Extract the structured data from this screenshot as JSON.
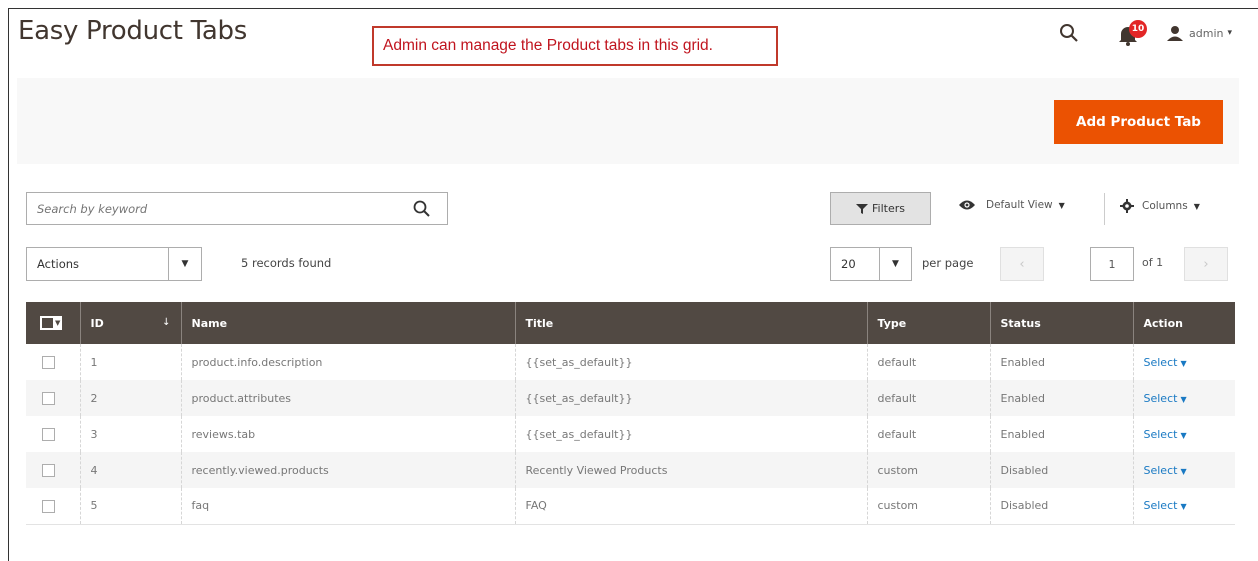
{
  "header": {
    "title": "Easy Product Tabs",
    "annotation": "Admin can manage the Product tabs in this grid.",
    "notification_count": "10",
    "user_name": "admin"
  },
  "actions_bar": {
    "add_button_label": "Add Product Tab"
  },
  "toolbar": {
    "search_placeholder": "Search by keyword",
    "filters_label": "Filters",
    "default_view_label": "Default View",
    "columns_label": "Columns",
    "actions_label": "Actions",
    "records_found": "5 records found",
    "per_page_value": "20",
    "per_page_label": "per page",
    "current_page": "1",
    "total_pages_label": "of 1"
  },
  "table": {
    "columns": [
      "ID",
      "Name",
      "Title",
      "Type",
      "Status",
      "Action"
    ],
    "rows": [
      {
        "id": "1",
        "name": "product.info.description",
        "title": "{{set_as_default}}",
        "type": "default",
        "status": "Enabled",
        "action": "Select"
      },
      {
        "id": "2",
        "name": "product.attributes",
        "title": "{{set_as_default}}",
        "type": "default",
        "status": "Enabled",
        "action": "Select"
      },
      {
        "id": "3",
        "name": "reviews.tab",
        "title": "{{set_as_default}}",
        "type": "default",
        "status": "Enabled",
        "action": "Select"
      },
      {
        "id": "4",
        "name": "recently.viewed.products",
        "title": "Recently Viewed Products",
        "type": "custom",
        "status": "Disabled",
        "action": "Select"
      },
      {
        "id": "5",
        "name": "faq",
        "title": "FAQ",
        "type": "custom",
        "status": "Disabled",
        "action": "Select"
      }
    ]
  },
  "colors": {
    "accent": "#eb5202",
    "header_bg": "#514943",
    "link": "#1979c3",
    "annotation": "#c0141e"
  },
  "icons": [
    "search-icon",
    "bell-icon",
    "user-icon",
    "filter-icon",
    "eye-icon",
    "gear-icon"
  ]
}
